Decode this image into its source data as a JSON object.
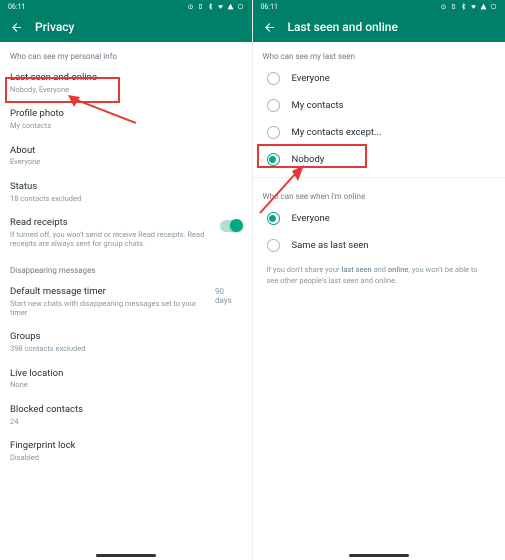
{
  "status": {
    "time": "06:11"
  },
  "left_screen": {
    "title": "Privacy",
    "section1": "Who can see my personal info",
    "items": {
      "last_seen": {
        "title": "Last seen and online",
        "sub": "Nobody, Everyone"
      },
      "profile_photo": {
        "title": "Profile photo",
        "sub": "My contacts"
      },
      "about": {
        "title": "About",
        "sub": "Everyone"
      },
      "status": {
        "title": "Status",
        "sub": "18 contacts excluded"
      },
      "read_receipts": {
        "title": "Read receipts",
        "sub": "If turned off, you won't send or receive Read receipts. Read receipts are always sent for group chats."
      }
    },
    "section2": "Disappearing messages",
    "items2": {
      "default_timer": {
        "title": "Default message timer",
        "sub": "Start new chats with disappearing messages set to your timer",
        "trailing": "90 days"
      },
      "groups": {
        "title": "Groups",
        "sub": "398 contacts excluded"
      },
      "live_location": {
        "title": "Live location",
        "sub": "None"
      },
      "blocked": {
        "title": "Blocked contacts",
        "sub": "24"
      },
      "fingerprint": {
        "title": "Fingerprint lock",
        "sub": "Disabled"
      }
    }
  },
  "right_screen": {
    "title": "Last seen and online",
    "section1": "Who can see my last seen",
    "options1": {
      "everyone": "Everyone",
      "my_contacts": "My contacts",
      "except": "My contacts except...",
      "nobody": "Nobody"
    },
    "section2": "Who can see when I'm online",
    "options2": {
      "everyone": "Everyone",
      "same": "Same as last seen"
    },
    "footnote": {
      "p1": "If you don't share your ",
      "b1": "last seen",
      "p2": " and ",
      "b2": "online",
      "p3": ", you won't be able to see other people's last seen and online."
    }
  }
}
